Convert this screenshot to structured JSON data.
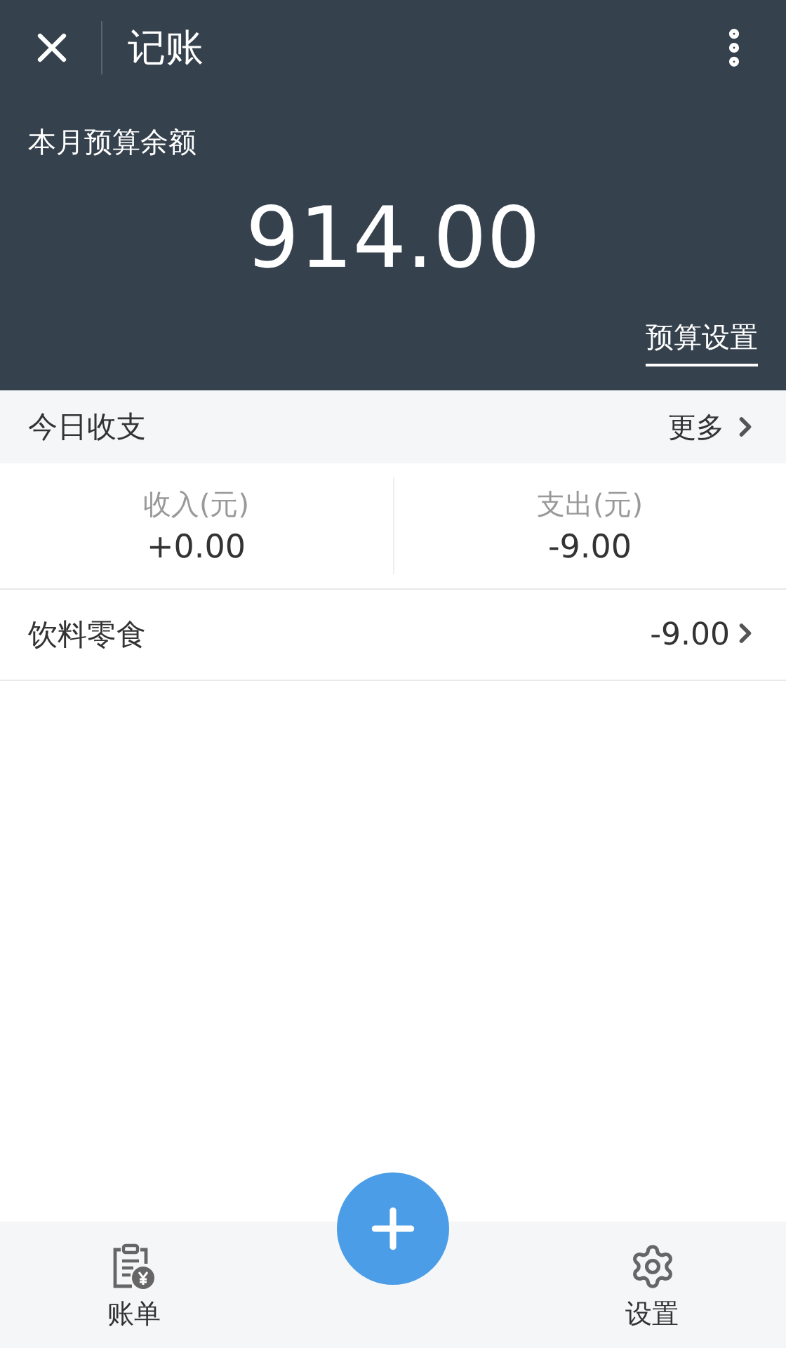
{
  "nav": {
    "title": "记账"
  },
  "budget": {
    "label": "本月预算余额",
    "amount": "914.00",
    "settings_link": "预算设置"
  },
  "today": {
    "title": "今日收支",
    "more": "更多"
  },
  "stats": [
    {
      "label": "收入(元)",
      "value": "+0.00"
    },
    {
      "label": "支出(元)",
      "value": "-9.00"
    }
  ],
  "entries": [
    {
      "category": "饮料零食",
      "amount": "-9.00"
    }
  ],
  "tab_bar": [
    {
      "kind": "bill",
      "label": "账单"
    },
    {
      "kind": "add"
    },
    {
      "kind": "settings",
      "label": "设置"
    }
  ]
}
